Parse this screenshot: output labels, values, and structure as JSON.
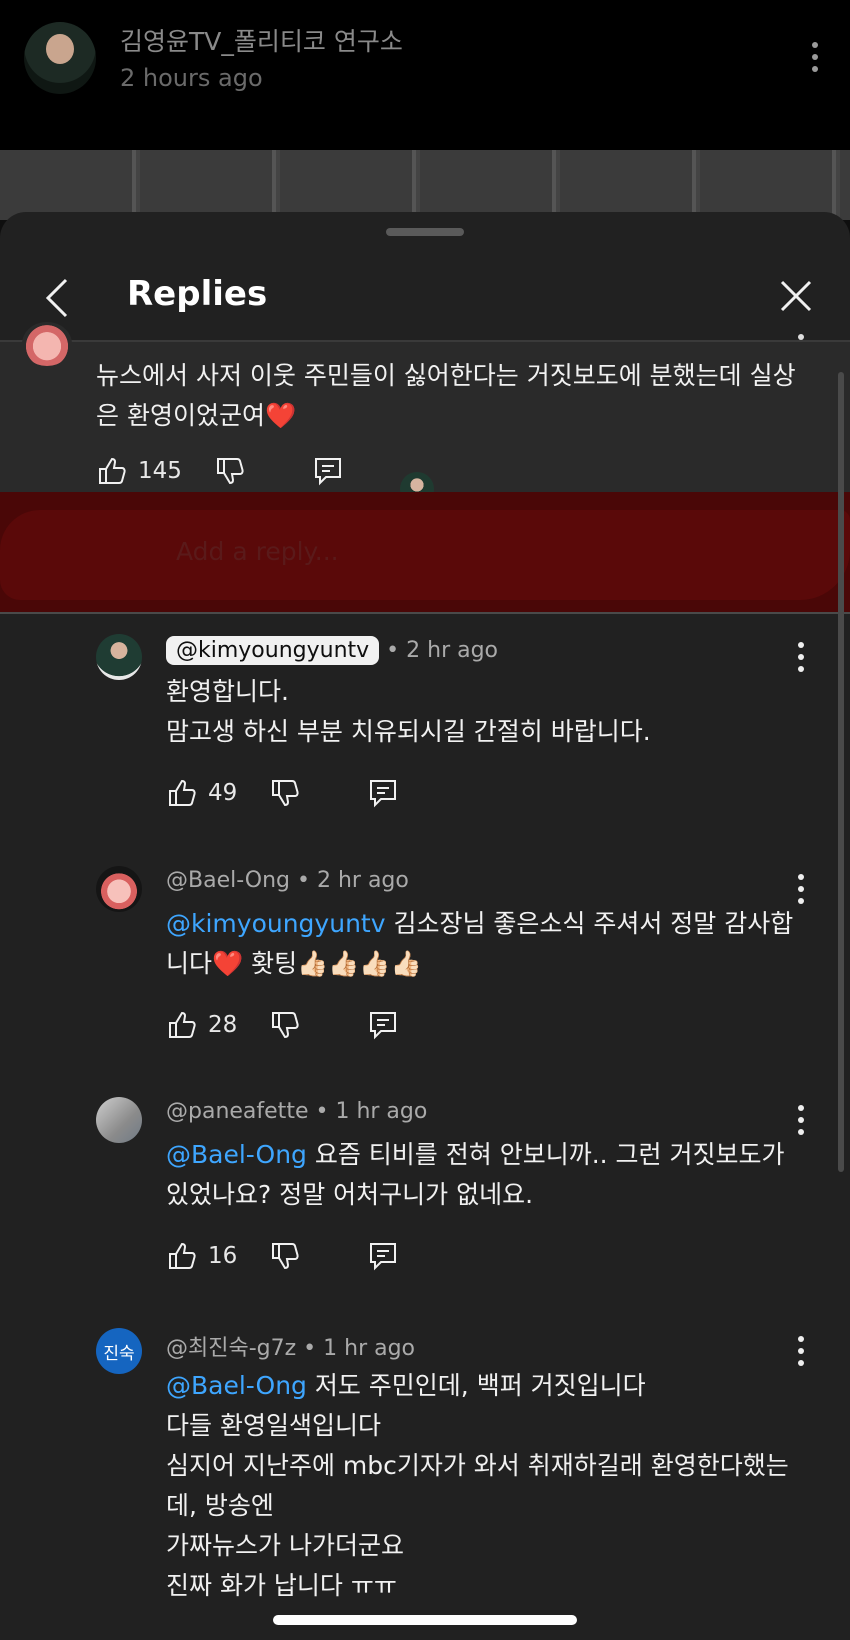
{
  "channel_header": {
    "name": "김영윤TV_폴리티코 연구소",
    "time": "2 hours ago"
  },
  "sheet": {
    "title": "Replies"
  },
  "parent_comment": {
    "text": "뉴스에서 사저 이웃 주민들이 싫어한다는 거짓보도에 분했는데 실상은 환영이었군여❤️",
    "likes": "145"
  },
  "add_reply": {
    "placeholder": "Add a reply..."
  },
  "replies": [
    {
      "handle": "@kimyoungyuntv",
      "time": "• 2 hr ago",
      "mention": "",
      "text": "환영합니다.\n맘고생 하신 부분 치유되시길 간절히 바랍니다.",
      "likes": "49",
      "avatar": "host-avatar"
    },
    {
      "handle": "@Bael-Ong",
      "time": "• 2 hr ago",
      "mention": "@kimyoungyuntv",
      "text": " 김소장님 좋은소식 주셔서 정말 감사합니다❤️   홧팅👍🏻👍🏻👍🏻👍🏻",
      "likes": "28",
      "avatar": "pink-bear-avatar"
    },
    {
      "handle": "@paneafette",
      "time": "• 1 hr ago",
      "mention": "@Bael-Ong",
      "text": " 요즘 티비를 전혀 안보니까.. 그런 거짓보도가 있었나요? 정말 어처구니가 없네요.",
      "likes": "16",
      "avatar": "photo-avatar"
    },
    {
      "handle": "@최진숙-g7z",
      "time": "• 1 hr ago",
      "mention": "@Bael-Ong",
      "text": " 저도 주민인데, 백퍼 거짓입니다\n다들 환영일색입니다\n심지어 지난주에 mbc기자가 와서 취재하길래 환영한다했는데, 방송엔\n가짜뉴스가 나가더군요\n진짜 화가 납니다 ㅠㅠ",
      "likes": "",
      "avatar_initials": "진숙",
      "avatar": "initials-avatar"
    }
  ],
  "colors": {
    "background": "#0f0f0f",
    "sheet": "#212121",
    "mention": "#3ea6ff",
    "initials_avatar": "#1565c0"
  }
}
